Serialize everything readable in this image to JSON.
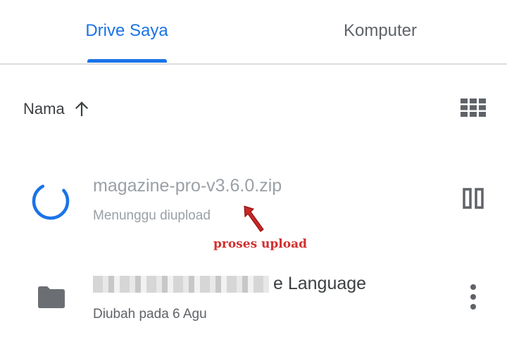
{
  "tabs": {
    "drive": "Drive Saya",
    "computer": "Komputer",
    "active": "drive"
  },
  "sort": {
    "label": "Nama",
    "direction": "ascending"
  },
  "files": {
    "upload": {
      "name": "magazine-pro-v3.6.0.zip",
      "status": "Menunggu diupload",
      "icon": "loading-spinner-icon",
      "action_icon": "pause-icon"
    },
    "folder": {
      "name_visible_part": "e Language",
      "meta": "Diubah pada 6 Agu",
      "icon": "folder-icon",
      "action_icon": "more-vert-icon"
    }
  },
  "annotation": {
    "text": "proses upload"
  },
  "colors": {
    "accent": "#1a73e8",
    "annotation": "#d32f2f",
    "muted_text": "#9aa0a6",
    "icon_gray": "#5f6368"
  }
}
